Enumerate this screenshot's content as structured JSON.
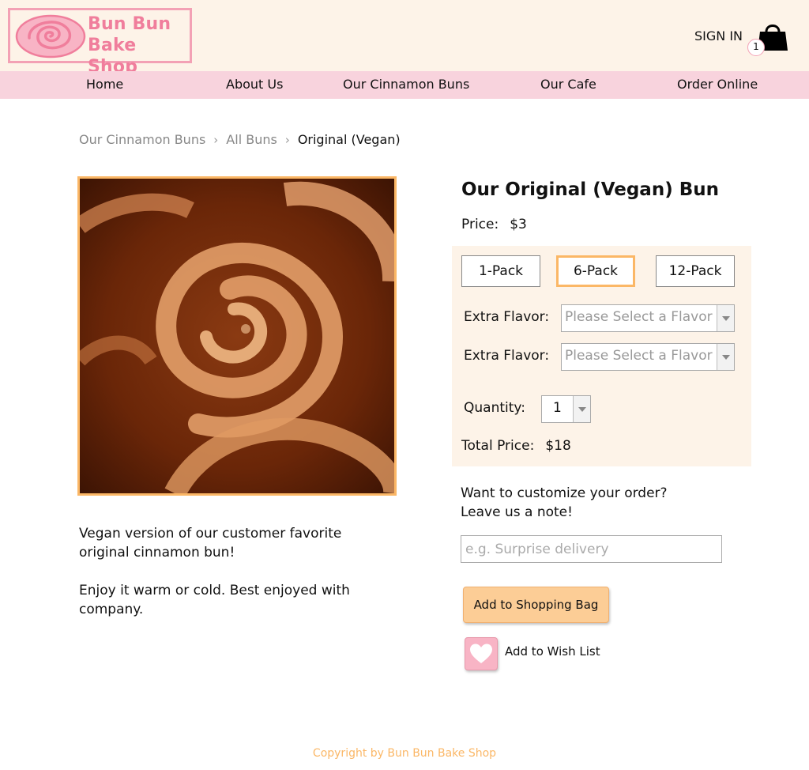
{
  "header": {
    "logo_line1": "Bun Bun",
    "logo_line2": "Bake Shop",
    "sign_in": "SIGN IN",
    "bag_count": "1"
  },
  "nav": {
    "items": [
      {
        "label": "Home"
      },
      {
        "label": "About Us"
      },
      {
        "label": "Our Cinnamon Buns"
      },
      {
        "label": "Our Cafe"
      },
      {
        "label": "Order Online"
      }
    ]
  },
  "breadcrumb": {
    "items": [
      {
        "label": "Our Cinnamon Buns"
      },
      {
        "label": "All Buns"
      },
      {
        "label": "Original (Vegan)"
      }
    ]
  },
  "product": {
    "title": "Our Original (Vegan) Bun",
    "price_label": "Price:",
    "price_value": "$3",
    "packs": [
      {
        "label": "1-Pack",
        "selected": false
      },
      {
        "label": "6-Pack",
        "selected": true
      },
      {
        "label": "12-Pack",
        "selected": false
      }
    ],
    "flavor_label": "Extra Flavor:",
    "flavor_placeholder": "Please Select a Flavor",
    "quantity_label": "Quantity:",
    "quantity_value": "1",
    "total_label": "Total Price:",
    "total_value": "$18",
    "description": [
      "Vegan version of our customer favorite original cinnamon bun!",
      "Enjoy it warm or cold. Best enjoyed with company."
    ]
  },
  "customize": {
    "line1": "Want to customize your order?",
    "line2": "Leave us a note!",
    "placeholder": "e.g. Surprise delivery"
  },
  "actions": {
    "add_to_bag": "Add to Shopping Bag",
    "wish_list": "Add to Wish List"
  },
  "footer": {
    "copyright": "Copyright by Bun Bun Bake Shop"
  },
  "colors": {
    "header_bg": "#fdf3e8",
    "nav_bg": "#f8d3dd",
    "brand_pink": "#f07e9c",
    "accent_orange": "#fbb766",
    "button_bg": "#fccd96",
    "wish_pink": "#f8b4c5"
  },
  "icons": {
    "logo": "cinnamon-swirl-logo",
    "bag": "shopping-bag-icon",
    "breadcrumb_separator": "chevron-right-icon",
    "dropdown": "caret-down-icon",
    "wish": "heart-icon"
  }
}
